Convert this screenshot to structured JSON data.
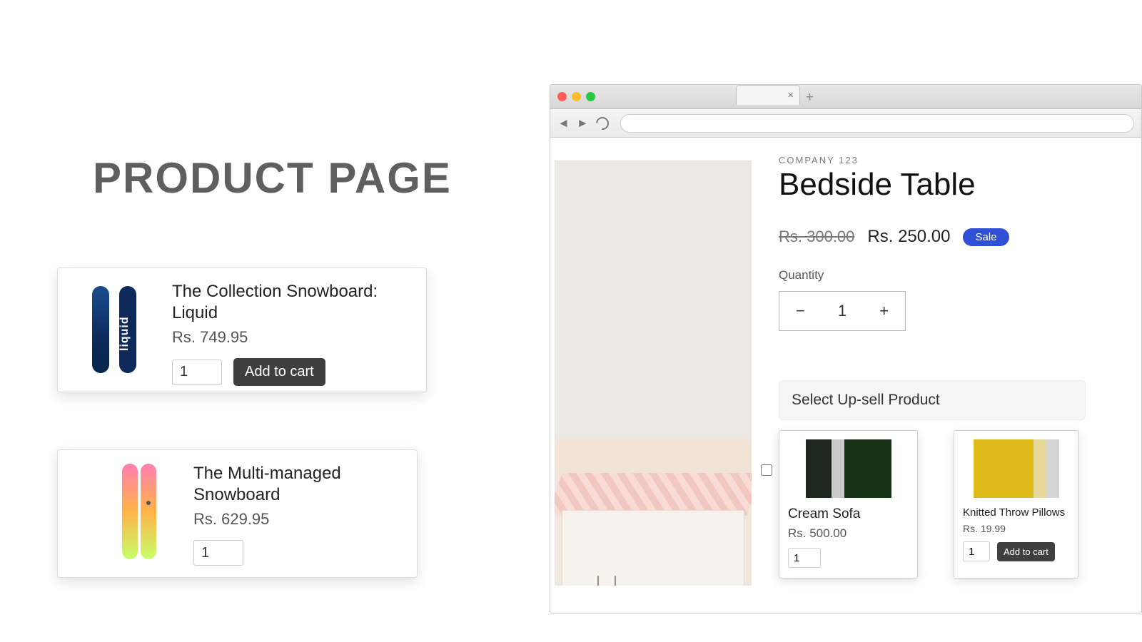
{
  "left": {
    "heading": "PRODUCT PAGE",
    "cards": [
      {
        "title": "The Collection Snowboard: Liquid",
        "price": "Rs. 749.95",
        "qty": "1",
        "add_label": "Add to cart"
      },
      {
        "title": "The Multi-managed Snowboard",
        "price": "Rs. 629.95",
        "qty": "1"
      }
    ]
  },
  "browser": {
    "product": {
      "vendor": "COMPANY 123",
      "title": "Bedside Table",
      "compare_price": "Rs. 300.00",
      "price": "Rs. 250.00",
      "sale_badge": "Sale",
      "qty_label": "Quantity",
      "qty_value": "1",
      "minus": "−",
      "plus": "+"
    },
    "upsell_header": "Select Up-sell Product",
    "upsells": [
      {
        "title": "Cream Sofa",
        "price": "Rs. 500.00",
        "qty": "1"
      },
      {
        "title": "Knitted Throw Pillows",
        "price": "Rs. 19.99",
        "qty": "1",
        "add_label": "Add to cart"
      }
    ]
  }
}
